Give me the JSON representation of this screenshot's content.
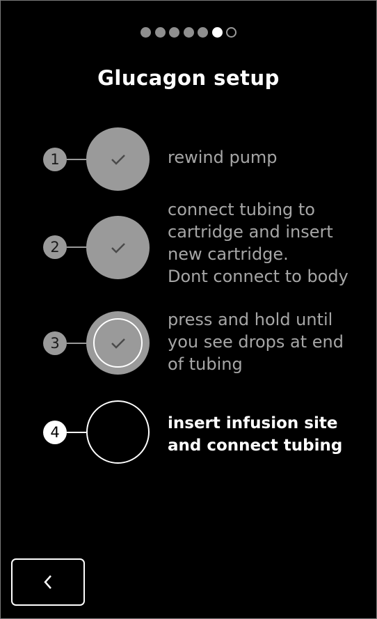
{
  "progress": {
    "dots": [
      "done",
      "done",
      "done",
      "done",
      "done",
      "current",
      "todo"
    ]
  },
  "title": "Glucagon setup",
  "steps": [
    {
      "number": "1",
      "lines": [
        "rewind pump"
      ],
      "state": "done"
    },
    {
      "number": "2",
      "lines": [
        "connect tubing to",
        "cartridge and insert",
        "new cartridge.",
        "Dont connect to body"
      ],
      "state": "done"
    },
    {
      "number": "3",
      "lines": [
        "press and hold until",
        "you see drops at end",
        "of tubing"
      ],
      "state": "done-selected"
    },
    {
      "number": "4",
      "lines": [
        "insert infusion site",
        "and connect tubing"
      ],
      "state": "current"
    }
  ],
  "icons": {
    "check": "check-icon",
    "back": "chevron-left-icon"
  },
  "colors": {
    "background": "#000000",
    "done_gray": "#9a9a9a",
    "active": "#ffffff",
    "muted_text": "#a6a6a6"
  }
}
